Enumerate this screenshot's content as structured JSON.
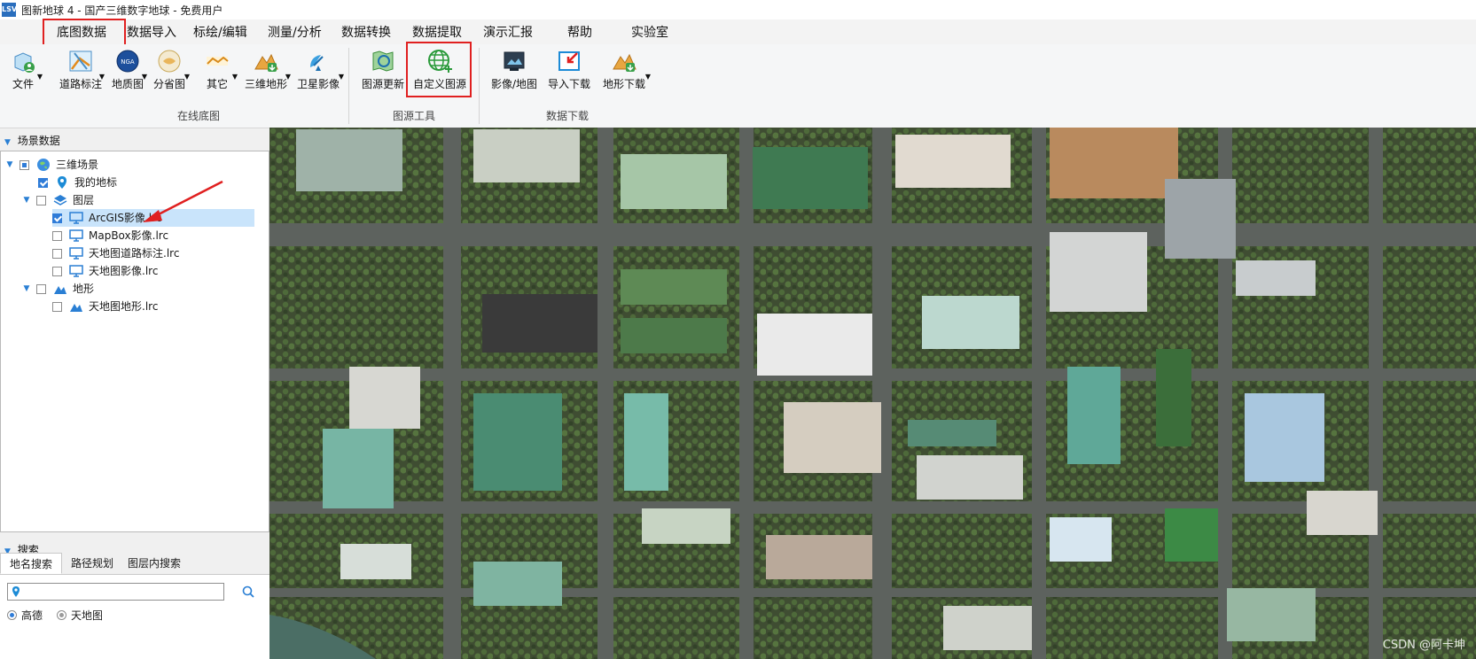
{
  "window": {
    "app_icon": "LSV",
    "title": "图新地球 4 - 国产三维数字地球 - 免费用户"
  },
  "menu": {
    "items": [
      "底图数据",
      "数据导入",
      "标绘/编辑",
      "测量/分析",
      "数据转换",
      "数据提取",
      "演示汇报",
      "帮助",
      "实验室"
    ],
    "active": "底图数据",
    "highlight_color": "#e02020"
  },
  "ribbon": {
    "file_label": "文件",
    "online_basemap": {
      "group_label": "在线底图",
      "buttons": [
        {
          "label": "道路标注",
          "icon": "road-annotation-icon"
        },
        {
          "label": "地质图",
          "icon": "geology-map-icon"
        },
        {
          "label": "分省图",
          "icon": "province-map-icon"
        },
        {
          "label": "其它",
          "icon": "other-map-icon"
        },
        {
          "label": "三维地形",
          "icon": "terrain-3d-icon"
        },
        {
          "label": "卫星影像",
          "icon": "satellite-icon"
        }
      ]
    },
    "source_tools": {
      "group_label": "图源工具",
      "buttons": [
        {
          "label": "图源更新",
          "icon": "map-refresh-icon"
        },
        {
          "label": "自定义图源",
          "icon": "custom-source-globe-icon"
        }
      ]
    },
    "data_download": {
      "group_label": "数据下载",
      "buttons": [
        {
          "label": "影像/地图",
          "icon": "image-map-icon"
        },
        {
          "label": "导入下载",
          "icon": "import-download-icon"
        },
        {
          "label": "地形下载",
          "icon": "terrain-download-icon"
        }
      ]
    }
  },
  "scene_panel": {
    "header": "场景数据",
    "tree": {
      "root": "三维场景",
      "my_places": "我的地标",
      "layers_group": "图层",
      "layers": [
        "ArcGIS影像.lrc",
        "MapBox影像.lrc",
        "天地图道路标注.lrc",
        "天地图影像.lrc"
      ],
      "terrain_group": "地形",
      "terrain_items": [
        "天地图地形.lrc"
      ]
    }
  },
  "search_panel": {
    "header": "搜索",
    "tabs": [
      "地名搜索",
      "路径规划",
      "图层内搜索"
    ],
    "active_tab": "地名搜索",
    "input_value": "",
    "providers": [
      "高德",
      "天地图"
    ],
    "selected_provider": "高德"
  },
  "map": {
    "watermark": "CSDN @阿卡坤"
  }
}
